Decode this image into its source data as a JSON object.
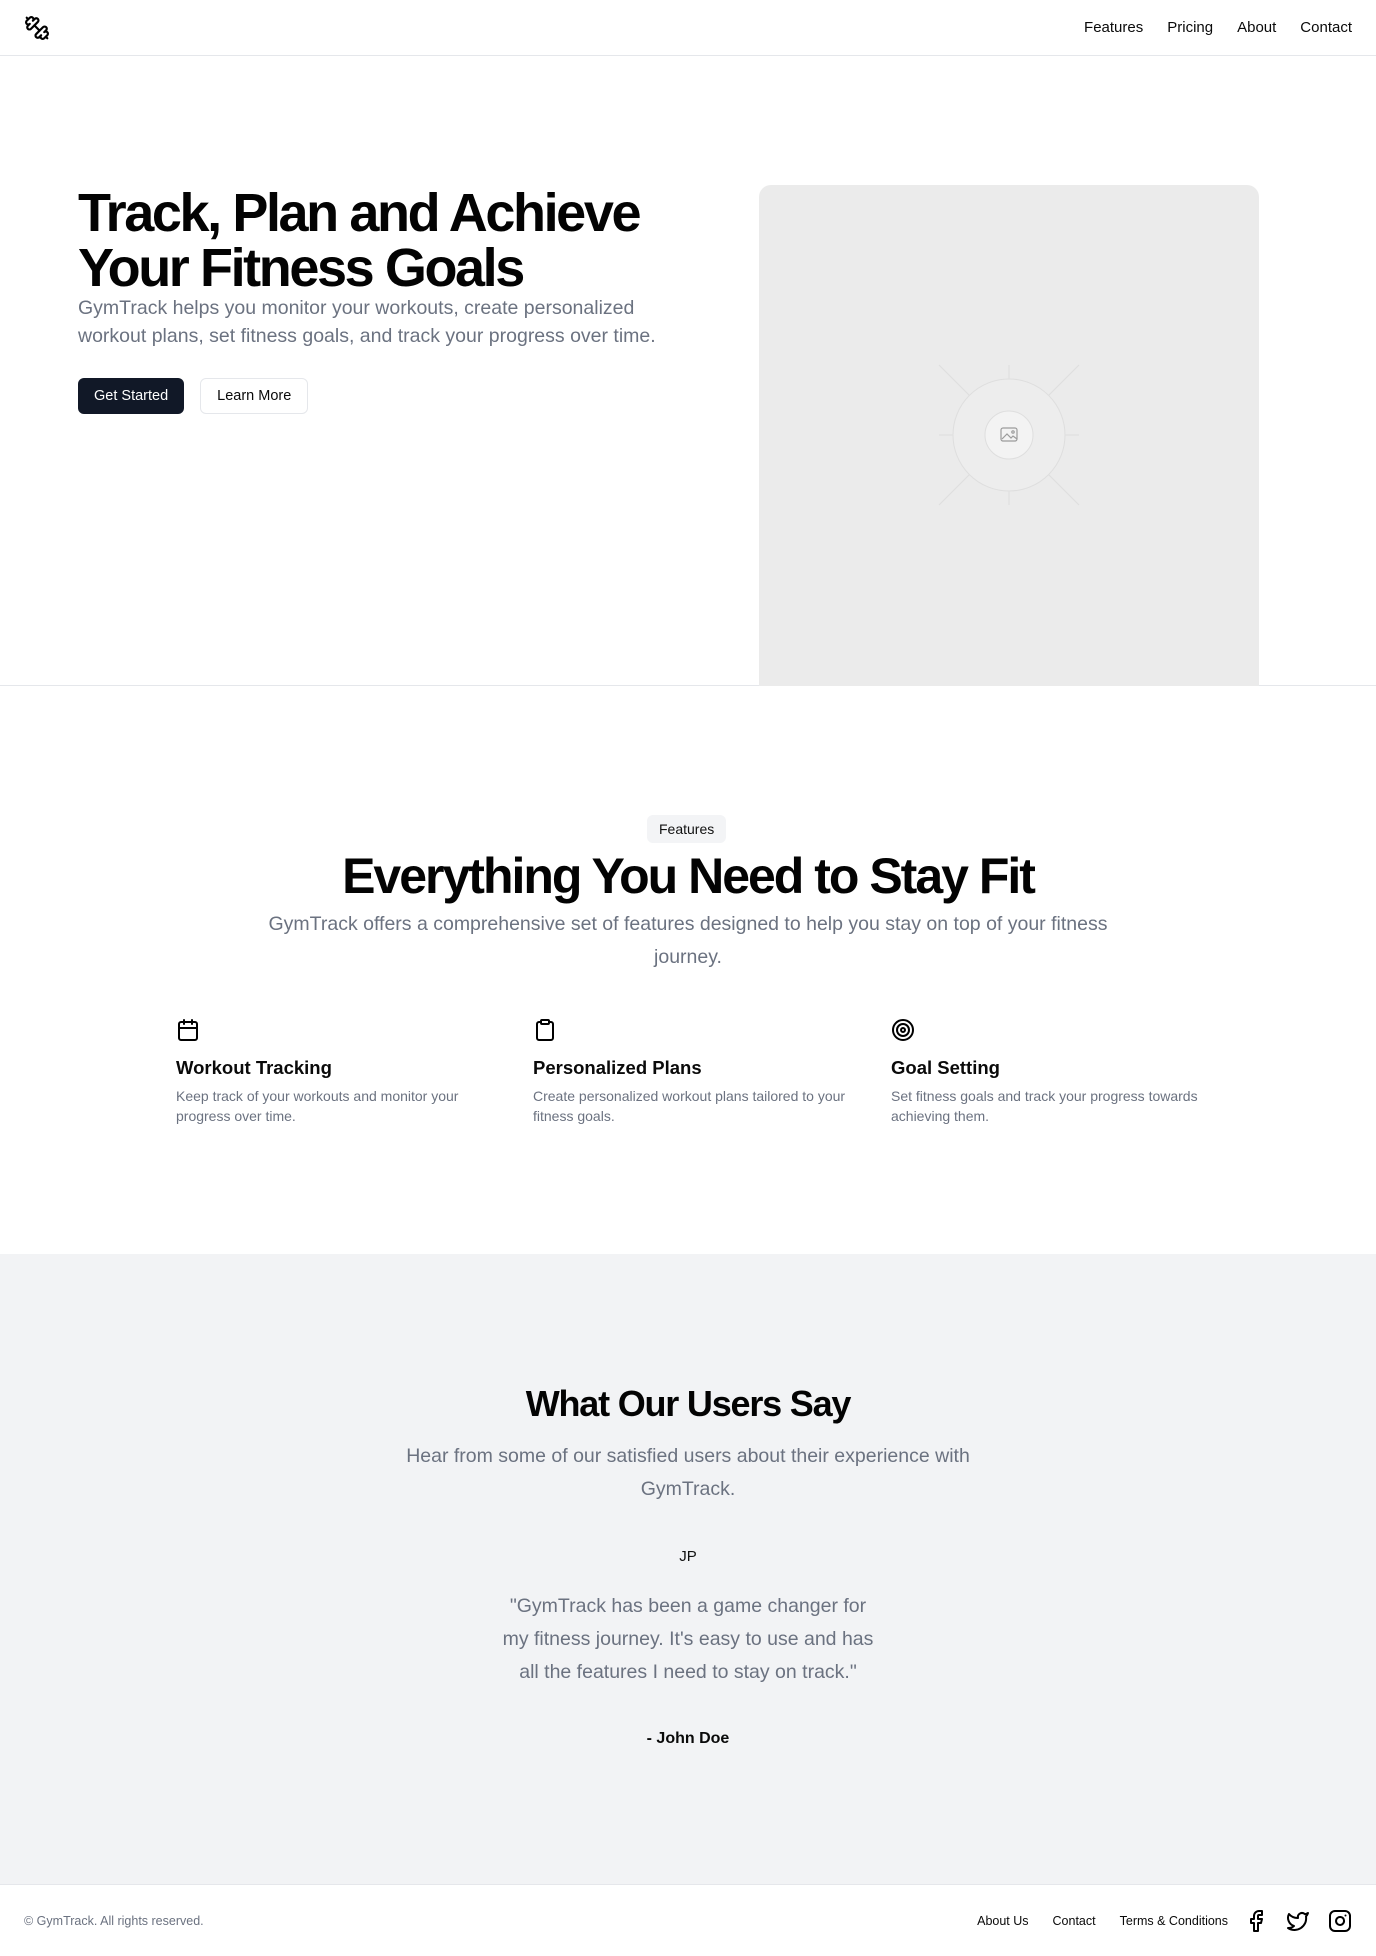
{
  "header": {
    "logo_icon": "dumbbell-icon",
    "nav": [
      {
        "label": "Features"
      },
      {
        "label": "Pricing"
      },
      {
        "label": "About"
      },
      {
        "label": "Contact"
      }
    ]
  },
  "hero": {
    "title": "Track, Plan and Achieve Your Fitness Goals",
    "subtitle": "GymTrack helps you monitor your workouts, create personalized workout plans, set fitness goals, and track your progress over time.",
    "primary_button": "Get Started",
    "secondary_button": "Learn More",
    "image_icon": "image-placeholder-icon"
  },
  "features": {
    "badge": "Features",
    "title": "Everything You Need to Stay Fit",
    "subtitle": "GymTrack offers a comprehensive set of features designed to help you stay on top of your fitness journey.",
    "items": [
      {
        "icon": "calendar-icon",
        "title": "Workout Tracking",
        "description": "Keep track of your workouts and monitor your progress over time."
      },
      {
        "icon": "clipboard-icon",
        "title": "Personalized Plans",
        "description": "Create personalized workout plans tailored to your fitness goals."
      },
      {
        "icon": "target-icon",
        "title": "Goal Setting",
        "description": "Set fitness goals and track your progress towards achieving them."
      }
    ]
  },
  "testimonials": {
    "title": "What Our Users Say",
    "subtitle": "Hear from some of our satisfied users about their experience with GymTrack.",
    "avatar_initials": "JP",
    "quote": "\"GymTrack has been a game changer for my fitness journey. It's easy to use and has all the features I need to stay on track.\"",
    "author": "- John Doe"
  },
  "footer": {
    "copyright": "© GymTrack. All rights reserved.",
    "links": [
      {
        "label": "About Us"
      },
      {
        "label": "Contact"
      },
      {
        "label": "Terms & Conditions"
      }
    ],
    "social_icons": [
      "facebook-icon",
      "twitter-icon",
      "instagram-icon"
    ]
  },
  "colors": {
    "primary_button_bg": "#111827",
    "muted_text": "#6b7280",
    "section_bg": "#f2f3f5",
    "image_placeholder_bg": "#ebebeb",
    "border": "#e5e7eb"
  }
}
